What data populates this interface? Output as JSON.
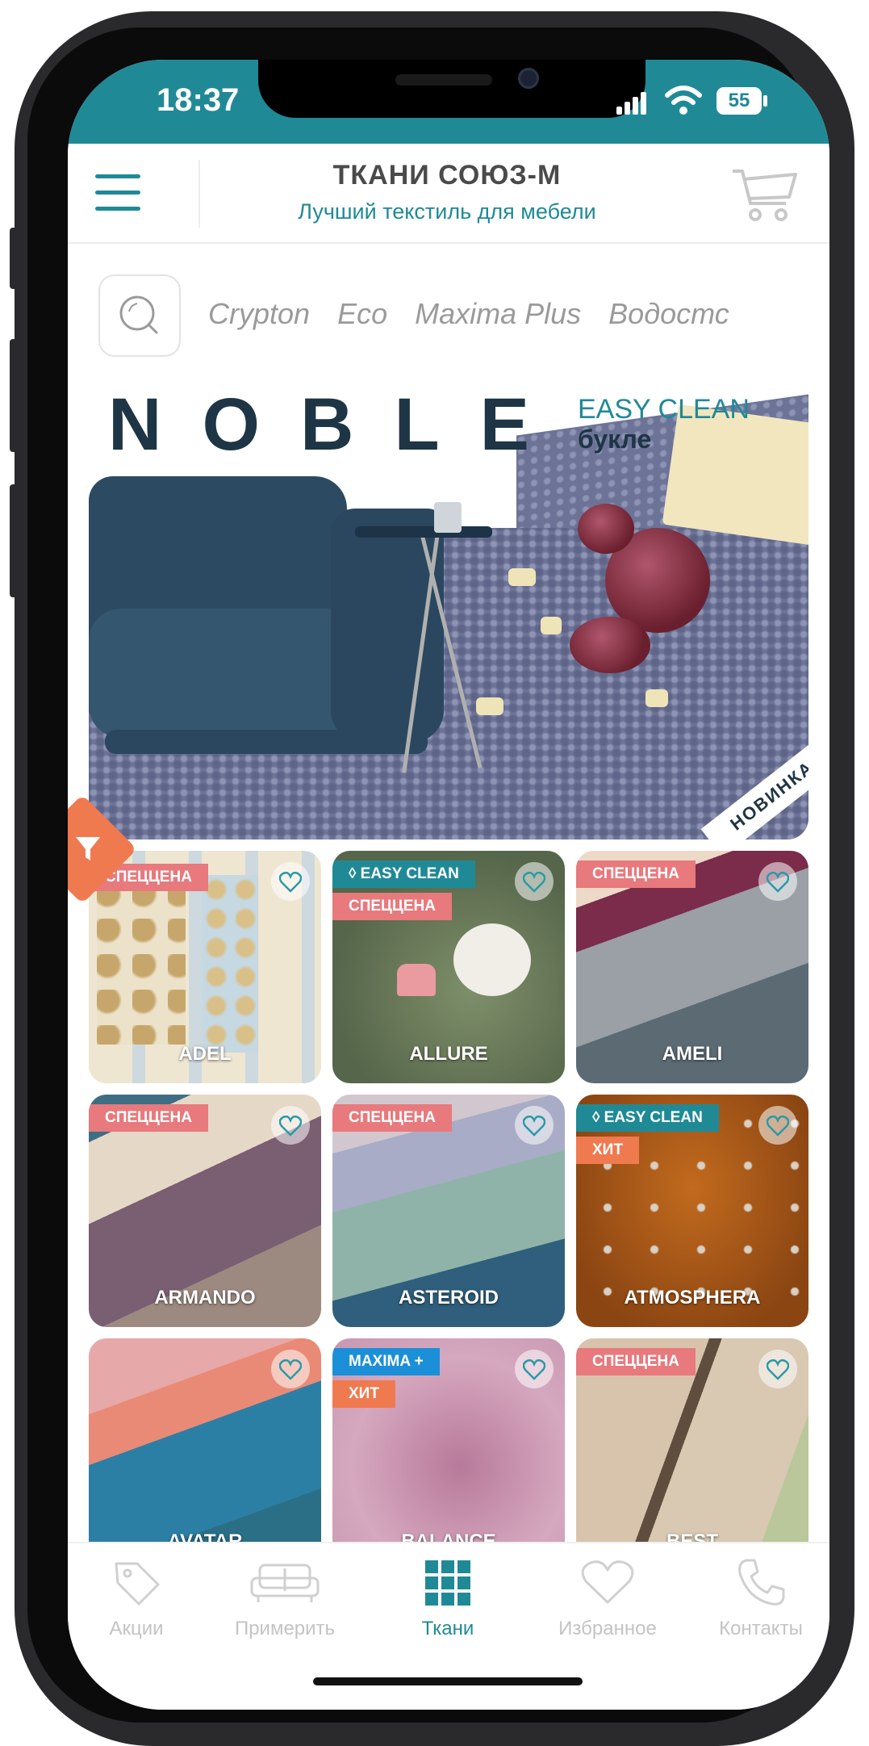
{
  "status_bar": {
    "time": "18:37",
    "battery": "55"
  },
  "header": {
    "title": "ТКАНИ СОЮЗ-М",
    "subtitle": "Лучший текстиль для мебели"
  },
  "categories": [
    "Crypton",
    "Eco",
    "Maxima Plus",
    "Водостс"
  ],
  "banner": {
    "title": "NOBLE",
    "tag": "EASY CLEAN",
    "subtitle": "букле",
    "corner": "НОВИНКА"
  },
  "badges": {
    "spec": "СПЕЦЦЕНА",
    "easy": "◊ EASY CLEAN",
    "hit": "ХИТ",
    "maxima": "MAXIMA +"
  },
  "colors": {
    "accent": "#1f8a96",
    "spec": "#e8797c",
    "easy": "#1f8a96",
    "hit": "#f07a4f",
    "maxima": "#1b8fd8"
  },
  "fabrics": [
    {
      "name": "ADEL",
      "badges": [
        "СПЕЦЦЕНА"
      ]
    },
    {
      "name": "ALLURE",
      "badges": [
        "◊ EASY CLEAN",
        "СПЕЦЦЕНА"
      ]
    },
    {
      "name": "AMELI",
      "badges": [
        "СПЕЦЦЕНА"
      ]
    },
    {
      "name": "ARMANDO",
      "badges": [
        "СПЕЦЦЕНА"
      ]
    },
    {
      "name": "ASTEROID",
      "badges": [
        "СПЕЦЦЕНА"
      ]
    },
    {
      "name": "ATMOSPHERA",
      "badges": [
        "◊ EASY CLEAN",
        "ХИТ"
      ]
    },
    {
      "name": "AVATAR",
      "badges": []
    },
    {
      "name": "BALANCE",
      "badges": [
        "MAXIMA +",
        "ХИТ"
      ]
    },
    {
      "name": "BEST",
      "badges": [
        "СПЕЦЦЕНА"
      ]
    }
  ],
  "tabbar": {
    "items": [
      {
        "label": "Акции",
        "icon": "tag-icon"
      },
      {
        "label": "Примерить",
        "icon": "sofa-icon"
      },
      {
        "label": "Ткани",
        "icon": "grid-icon"
      },
      {
        "label": "Избранное",
        "icon": "heart-icon"
      },
      {
        "label": "Контакты",
        "icon": "phone-icon"
      }
    ],
    "active": "Ткани"
  }
}
